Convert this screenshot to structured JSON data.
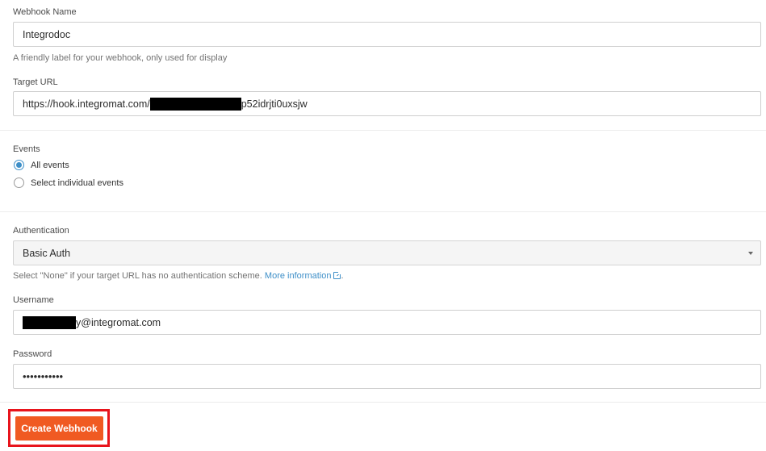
{
  "webhook_name": {
    "label": "Webhook Name",
    "value": "Integrodoc",
    "hint": "A friendly label for your webhook, only used for display"
  },
  "target_url": {
    "label": "Target URL",
    "value_prefix": "https://hook.integromat.com/",
    "value_suffix": "p52idrjti0uxsjw"
  },
  "events": {
    "label": "Events",
    "options": [
      {
        "label": "All events",
        "selected": true
      },
      {
        "label": "Select individual events",
        "selected": false
      }
    ]
  },
  "authentication": {
    "label": "Authentication",
    "selected": "Basic Auth",
    "hint_text": "Select \"None\" if your target URL has no authentication scheme.",
    "hint_link": "More information",
    "hint_end": "."
  },
  "username": {
    "label": "Username",
    "value_suffix": "y@integromat.com"
  },
  "password": {
    "label": "Password",
    "value": "•••••••••••"
  },
  "actions": {
    "create_label": "Create Webhook"
  },
  "colors": {
    "primary_button": "#f05a22",
    "highlight": "#e8141c",
    "link": "#3e8fc8"
  }
}
